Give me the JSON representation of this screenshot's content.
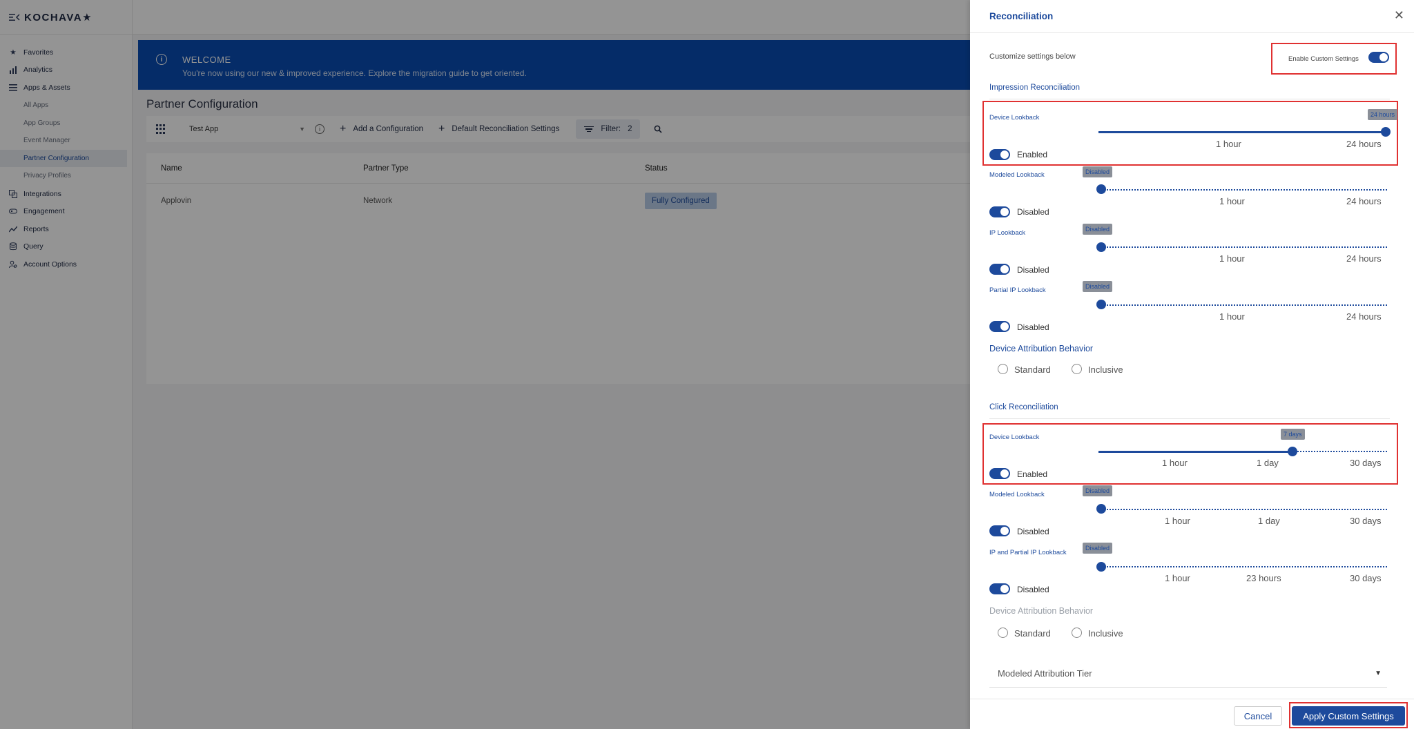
{
  "app": {
    "logo": "KOCHAVA★"
  },
  "sidebar": {
    "items": [
      {
        "label": "Favorites",
        "icon": "star-icon"
      },
      {
        "label": "Analytics",
        "icon": "bar-chart-icon"
      },
      {
        "label": "Apps & Assets",
        "icon": "apps-icon"
      }
    ],
    "sub_items": [
      "All Apps",
      "App Groups",
      "Event Manager",
      "Partner Configuration",
      "Privacy Profiles"
    ],
    "items_after": [
      {
        "label": "Integrations",
        "icon": "integrations-icon"
      },
      {
        "label": "Engagement",
        "icon": "engagement-icon"
      },
      {
        "label": "Reports",
        "icon": "reports-icon"
      },
      {
        "label": "Query",
        "icon": "database-icon"
      },
      {
        "label": "Account Options",
        "icon": "account-icon"
      }
    ]
  },
  "banner": {
    "title": "WELCOME",
    "text": "You're now using our new & improved experience. Explore the migration guide to get oriented."
  },
  "page": {
    "title": "Partner Configuration",
    "app_select": "Test App",
    "add_config": "Add a Configuration",
    "default_settings": "Default Reconciliation Settings",
    "filter_label": "Filter:",
    "filter_count": "2"
  },
  "table": {
    "headers": [
      "Name",
      "Partner Type",
      "Status"
    ],
    "rows": [
      {
        "name": "Applovin",
        "type": "Network",
        "status": "Fully Configured"
      }
    ]
  },
  "drawer": {
    "title": "Reconciliation",
    "customize_text": "Customize settings below",
    "enable_custom": "Enable Custom Settings",
    "impression": {
      "title": "Impression Reconciliation",
      "device": {
        "label": "Device Lookback",
        "tooltip": "24 hours",
        "toggle": "Enabled",
        "tick1": "1 hour",
        "tick2": "24 hours"
      },
      "modeled": {
        "label": "Modeled Lookback",
        "tooltip": "Disabled",
        "toggle": "Disabled",
        "tick1": "1 hour",
        "tick2": "24 hours"
      },
      "ip": {
        "label": "IP Lookback",
        "tooltip": "Disabled",
        "toggle": "Disabled",
        "tick1": "1 hour",
        "tick2": "24 hours"
      },
      "partial_ip": {
        "label": "Partial IP Lookback",
        "tooltip": "Disabled",
        "toggle": "Disabled",
        "tick1": "1 hour",
        "tick2": "24 hours"
      },
      "behavior_title": "Device Attribution Behavior",
      "standard": "Standard",
      "inclusive": "Inclusive"
    },
    "click": {
      "title": "Click Reconciliation",
      "device": {
        "label": "Device Lookback",
        "tooltip": "7 days",
        "toggle": "Enabled",
        "tick1": "1 hour",
        "tick2": "1 day",
        "tick3": "30 days"
      },
      "modeled": {
        "label": "Modeled Lookback",
        "tooltip": "Disabled",
        "toggle": "Disabled",
        "tick1": "1 hour",
        "tick2": "1 day",
        "tick3": "30 days"
      },
      "ip": {
        "label": "IP and Partial IP Lookback",
        "tooltip": "Disabled",
        "toggle": "Disabled",
        "tick1": "1 hour",
        "tick2": "23 hours",
        "tick3": "30 days"
      },
      "behavior_title": "Device Attribution Behavior",
      "standard": "Standard",
      "inclusive": "Inclusive"
    },
    "tier_placeholder": "Modeled Attribution Tier",
    "cancel": "Cancel",
    "apply": "Apply Custom Settings"
  },
  "colors": {
    "brand": "#1d4a9c",
    "banner": "#0a4db3",
    "highlight": "#e03131"
  }
}
